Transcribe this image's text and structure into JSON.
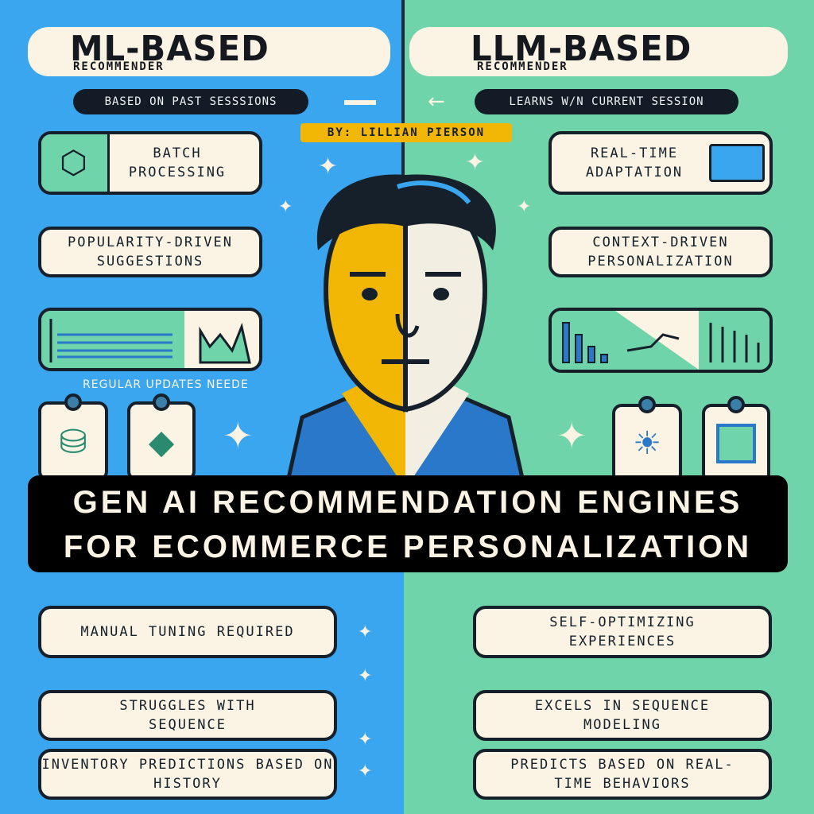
{
  "colors": {
    "left_bg": "#3aa6ef",
    "right_bg": "#6fd4aa",
    "cream": "#fbf3e3",
    "dark": "#131c26",
    "byline": "#f2b705"
  },
  "left": {
    "title": "ML-BASED",
    "subtitle": "RECOMMENDER",
    "tagline": "BASED ON PAST SESSSIONS",
    "batch": "BATCH PROCESSING",
    "popularity": "POPULARITY-DRIVEN SUGGESTIONS",
    "updates": "REGULAR UPDATES NEEDE",
    "manual": "MANUAL TUNING REQUIRED",
    "struggles": "STRUGGLES WITH SEQUENCE",
    "inventory": "INVENTORY PREDICTIONS BASED ON HISTORY"
  },
  "right": {
    "title": "LLM-BASED",
    "subtitle": "RECOMMENDER",
    "tagline": "LEARNS W/N CURRENT SESSION",
    "realtime": "REAL-TIME ADAPTATION",
    "context": "CONTEXT-DRIVEN PERSONALIZATION",
    "self": "SELF-OPTIMIZING EXPERIENCES",
    "excels": "EXCELS IN SEQUENCE MODELING",
    "predicts": "PREDICTS BASED ON REAL-TIME BEHAVIORS"
  },
  "byline": "BY: LILLIAN PIERSON",
  "banner": {
    "line1": "GEN AI RECOMMENDATION ENGINES",
    "line2": "FOR ECOMMERCE PERSONALIZATION"
  },
  "icons": [
    "cube-icon",
    "window-icon",
    "bar-chart-icon",
    "line-chart-icon",
    "database-icon",
    "gem-icon",
    "lightbulb-icon",
    "chip-icon",
    "sparkle-icon",
    "arrow-left-icon"
  ]
}
